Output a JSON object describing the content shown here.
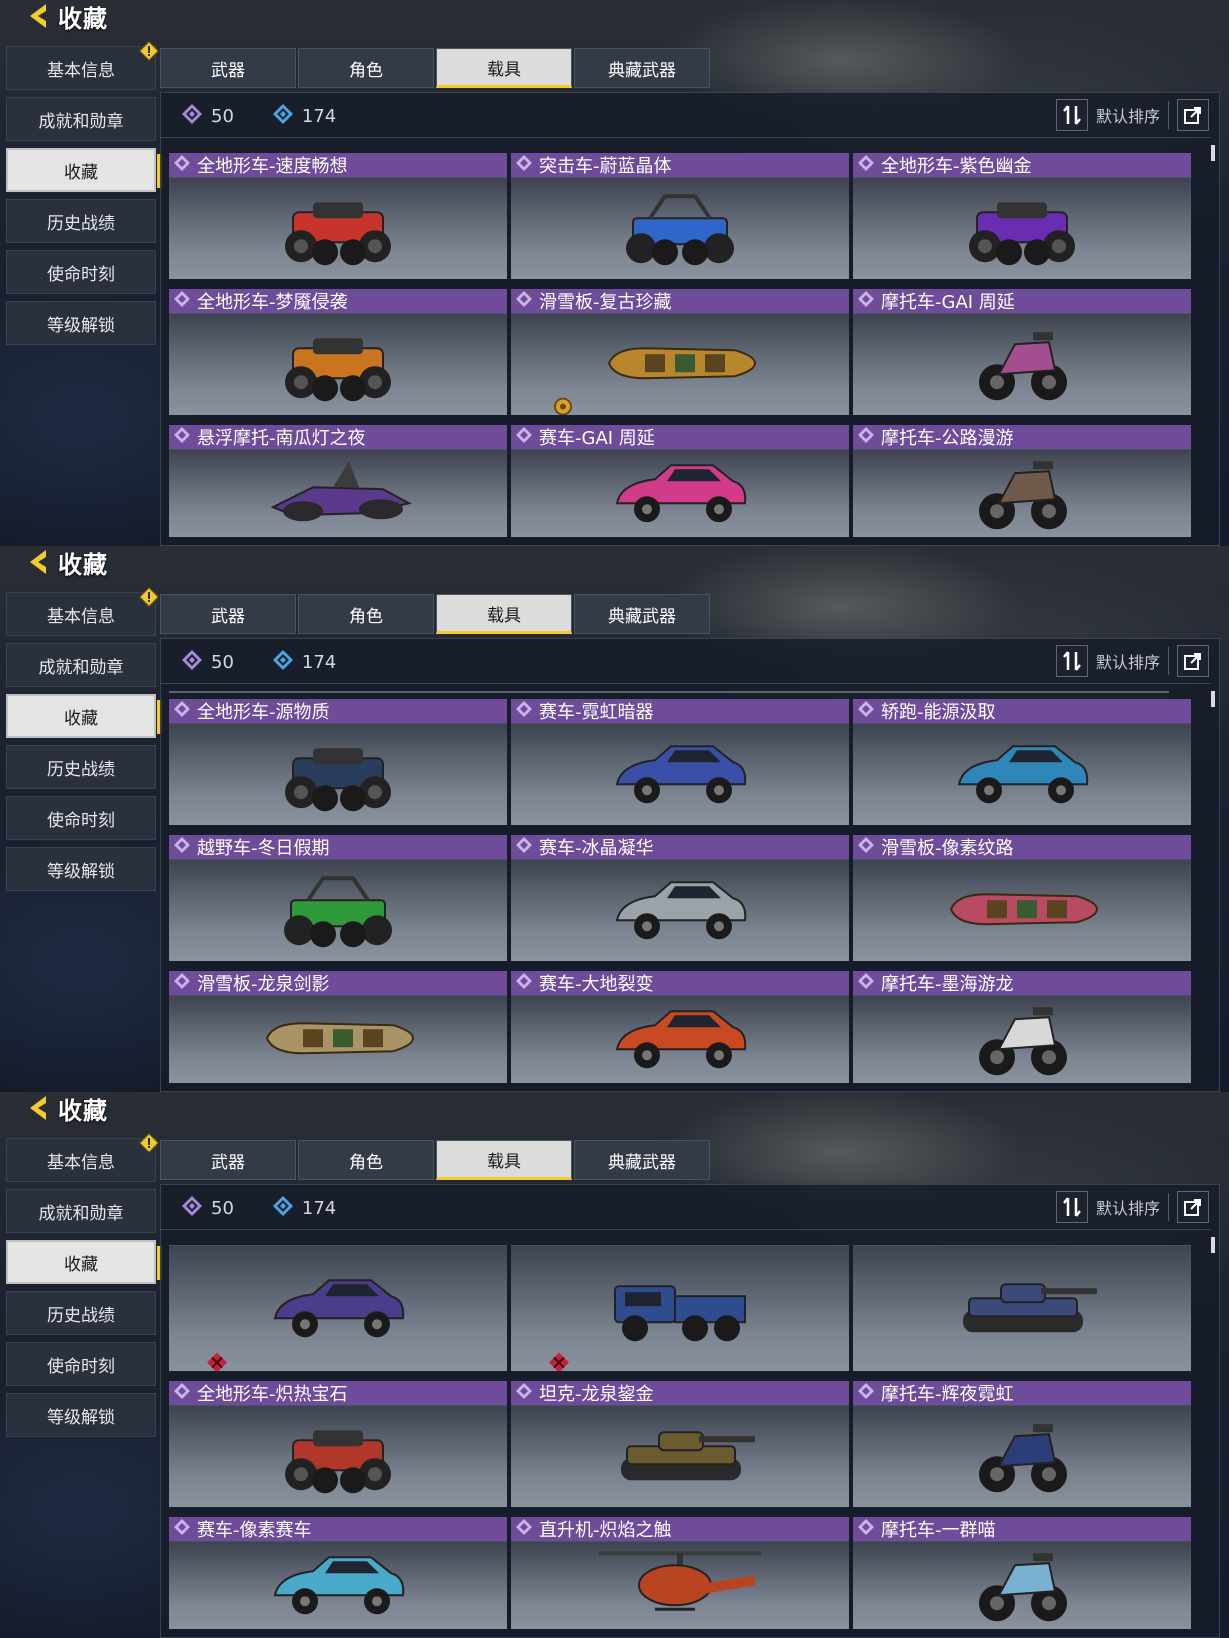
{
  "header": {
    "title": "收藏"
  },
  "sidebar": {
    "items": [
      {
        "label": "基本信息",
        "warning": true
      },
      {
        "label": "成就和勋章"
      },
      {
        "label": "收藏",
        "active": true
      },
      {
        "label": "历史战绩"
      },
      {
        "label": "使命时刻"
      },
      {
        "label": "等级解锁"
      }
    ]
  },
  "tabs": [
    {
      "label": "武器"
    },
    {
      "label": "角色"
    },
    {
      "label": "载具",
      "active": true
    },
    {
      "label": "典藏武器"
    }
  ],
  "stats": {
    "purple_count": "50",
    "blue_count": "174"
  },
  "sort": {
    "label": "默认排序",
    "sort_icon": "sort-icon",
    "share_icon": "share-icon"
  },
  "colors": {
    "accent": "#f2cc2a",
    "card_header": "#6e4c9a",
    "purple_gem": "#a98ae0",
    "blue_gem": "#4ea6e8",
    "badge_red": "#c8203a"
  },
  "panels": [
    {
      "cards": [
        {
          "name": "全地形车-速度畅想",
          "vehicle": "atv",
          "color": "#c8342c"
        },
        {
          "name": "突击车-蔚蓝晶体",
          "vehicle": "buggy",
          "color": "#2f66c9"
        },
        {
          "name": "全地形车-紫色幽金",
          "vehicle": "atv",
          "color": "#6a2cb0"
        },
        {
          "name": "全地形车-梦魇侵袭",
          "vehicle": "atv",
          "color": "#c9741e"
        },
        {
          "name": "滑雪板-复古珍藏",
          "vehicle": "sled",
          "color": "#b8862c",
          "badge": "bronze"
        },
        {
          "name": "摩托车-GAI 周延",
          "vehicle": "moto",
          "color": "#a34e8e"
        },
        {
          "name": "悬浮摩托-南瓜灯之夜",
          "vehicle": "hover",
          "color": "#5a3a8c"
        },
        {
          "name": "赛车-GAI 周延",
          "vehicle": "car",
          "color": "#d23b8a"
        },
        {
          "name": "摩托车-公路漫游",
          "vehicle": "moto",
          "color": "#6f5a4c"
        }
      ]
    },
    {
      "cards": [
        {
          "name": "全地形车-源物质",
          "vehicle": "atv",
          "color": "#2a3e5c"
        },
        {
          "name": "赛车-霓虹暗器",
          "vehicle": "car",
          "color": "#3b4fa8"
        },
        {
          "name": "轿跑-能源汲取",
          "vehicle": "car",
          "color": "#2f86b8"
        },
        {
          "name": "越野车-冬日假期",
          "vehicle": "buggy",
          "color": "#2f9a3a"
        },
        {
          "name": "赛车-冰晶凝华",
          "vehicle": "car",
          "color": "#9aa3a8"
        },
        {
          "name": "滑雪板-像素纹路",
          "vehicle": "sled",
          "color": "#b84a62"
        },
        {
          "name": "滑雪板-龙泉剑影",
          "vehicle": "sled",
          "color": "#a89466"
        },
        {
          "name": "赛车-大地裂变",
          "vehicle": "car",
          "color": "#c84a22"
        },
        {
          "name": "摩托车-墨海游龙",
          "vehicle": "moto",
          "color": "#d8d8d8"
        }
      ]
    },
    {
      "cards": [
        {
          "name": "",
          "vehicle": "car",
          "color": "#4a3e8c",
          "badge": "red"
        },
        {
          "name": "",
          "vehicle": "truck",
          "color": "#2f4c8e",
          "badge": "red"
        },
        {
          "name": "",
          "vehicle": "tank",
          "color": "#3c4a7a"
        },
        {
          "name": "全地形车-炽热宝石",
          "vehicle": "atv",
          "color": "#b0382a"
        },
        {
          "name": "坦克-龙泉鋆金",
          "vehicle": "tank",
          "color": "#6a5c2e"
        },
        {
          "name": "摩托车-辉夜霓虹",
          "vehicle": "moto",
          "color": "#2c3e78"
        },
        {
          "name": "赛车-像素赛车",
          "vehicle": "car",
          "color": "#4aa8c8"
        },
        {
          "name": "直升机-炽焰之触",
          "vehicle": "heli",
          "color": "#b84422"
        },
        {
          "name": "摩托车-一群喵",
          "vehicle": "moto",
          "color": "#7ab0d0"
        }
      ]
    }
  ]
}
